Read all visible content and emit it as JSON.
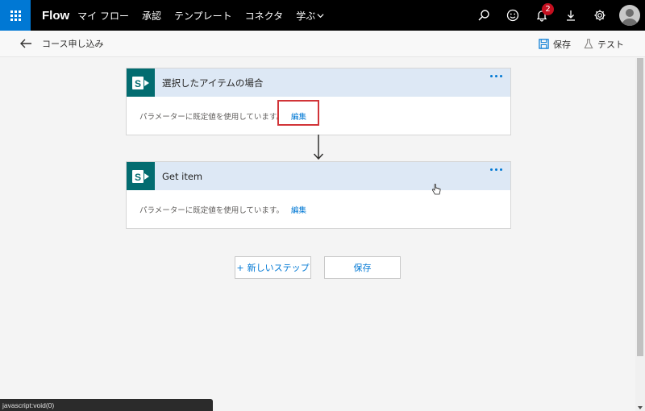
{
  "topbar": {
    "brand": "Flow",
    "nav": [
      {
        "label": "マイ フロー"
      },
      {
        "label": "承認"
      },
      {
        "label": "テンプレート"
      },
      {
        "label": "コネクタ"
      },
      {
        "label": "学ぶ"
      }
    ],
    "notification_count": "2",
    "accent_color": "#0078d4"
  },
  "subbar": {
    "flow_name": "コース申し込み",
    "save_label": "保存",
    "test_label": "テスト"
  },
  "cards": [
    {
      "title": "選択したアイテムの場合",
      "body_text": "パラメーターに既定値を使用しています。",
      "edit_label": "編集",
      "icon": "sharepoint-icon"
    },
    {
      "title": "Get item",
      "body_text": "パラメーターに既定値を使用しています。",
      "edit_label": "編集",
      "icon": "sharepoint-icon"
    }
  ],
  "actions": {
    "new_step_label": "新しいステップ",
    "new_step_prefix": "+",
    "save_label": "保存"
  },
  "statusbar": {
    "text": "javascript:void(0)"
  }
}
